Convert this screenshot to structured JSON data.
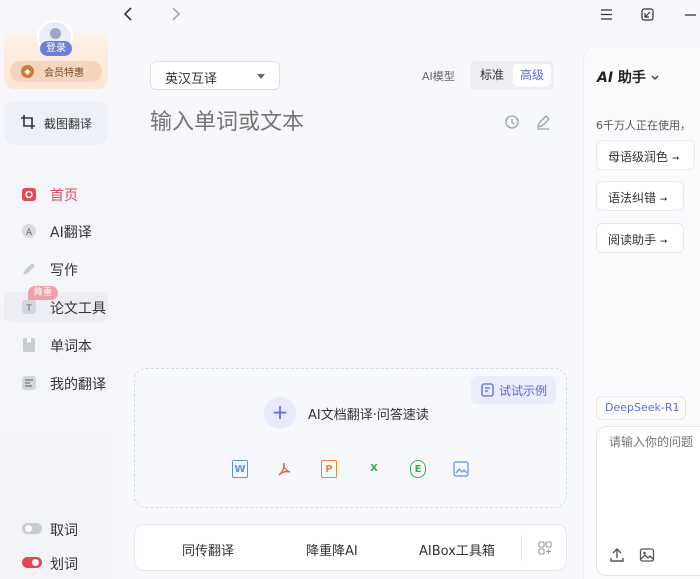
{
  "sidebar": {
    "login_label": "登录",
    "vip_label": "会员特惠",
    "screenshot_translate": "截图翻译",
    "items": [
      {
        "label": "首页"
      },
      {
        "label": "AI翻译"
      },
      {
        "label": "写作"
      },
      {
        "label": "论文工具"
      },
      {
        "label": "单词本"
      },
      {
        "label": "我的翻译"
      }
    ],
    "badge": "降重",
    "toggle_pick": "取词",
    "toggle_select": "划词"
  },
  "main": {
    "lang_pair": "英汉互译",
    "model_label": "AI模型",
    "model_options": [
      "标准",
      "高级"
    ],
    "input_placeholder": "输入单词或文本",
    "try_example": "试试示例",
    "doc_label": "AI文档翻译·问答速读",
    "file_types": [
      "W",
      "P",
      "P",
      "X",
      "E",
      "I"
    ],
    "bottom_items": [
      "同传翻译",
      "降重降AI",
      "AIBox工具箱"
    ]
  },
  "assistant": {
    "title_ai": "AI",
    "title": "助手",
    "users_text": "6千万人正在使用，",
    "chips": [
      "母语级润色",
      "语法纠错",
      "阅读助手"
    ],
    "model": "DeepSeek-R1",
    "input_placeholder": "请输入你的问题"
  },
  "colors": {
    "accent": "#5b6bdc",
    "active": "#e8455a",
    "brand_bg": "#f7f8fb"
  }
}
